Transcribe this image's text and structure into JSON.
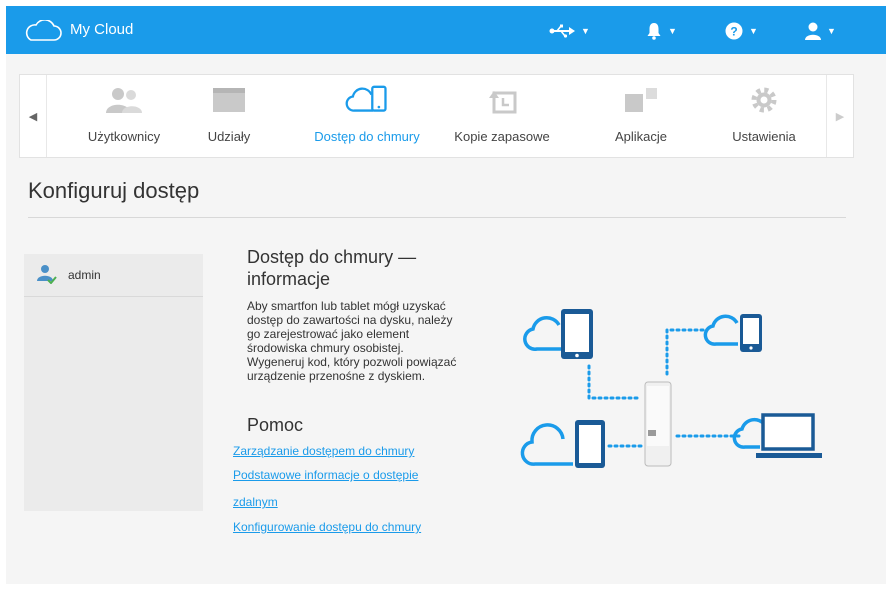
{
  "header": {
    "app_title": "My Cloud",
    "icons": [
      "cloud-logo",
      "usb-icon",
      "bell-icon",
      "help-icon",
      "user-icon"
    ],
    "accent_color": "#1a9bea"
  },
  "nav": {
    "items": [
      {
        "label": "Użytkownicy",
        "icon": "users-icon"
      },
      {
        "label": "Udziały",
        "icon": "folder-icon"
      },
      {
        "label": "Dostęp do chmury",
        "icon": "cloud-device-icon",
        "active": true
      },
      {
        "label": "Kopie zapasowe",
        "icon": "backup-icon"
      },
      {
        "label": "Aplikacje",
        "icon": "apps-icon"
      },
      {
        "label": "Ustawienia",
        "icon": "gear-icon"
      }
    ]
  },
  "page": {
    "title": "Konfiguruj dostęp"
  },
  "users": {
    "items": [
      {
        "name": "admin"
      }
    ]
  },
  "info": {
    "title_line1": "Dostęp do chmury —",
    "title_line2": "informacje",
    "body_lines": [
      "Aby smartfon lub tablet mógł uzyskać",
      "dostęp do zawartości na dysku, należy",
      "go zarejestrować jako element",
      "środowiska chmury osobistej.",
      "Wygeneruj kod, który pozwoli powiązać",
      "urządzenie przenośne z dyskiem."
    ]
  },
  "help": {
    "title": "Pomoc",
    "links": [
      "Zarządzanie dostępem do chmury",
      "Podstawowe informacje o dostępie",
      "zdalnym",
      "Konfigurowanie dostępu do chmury"
    ]
  }
}
